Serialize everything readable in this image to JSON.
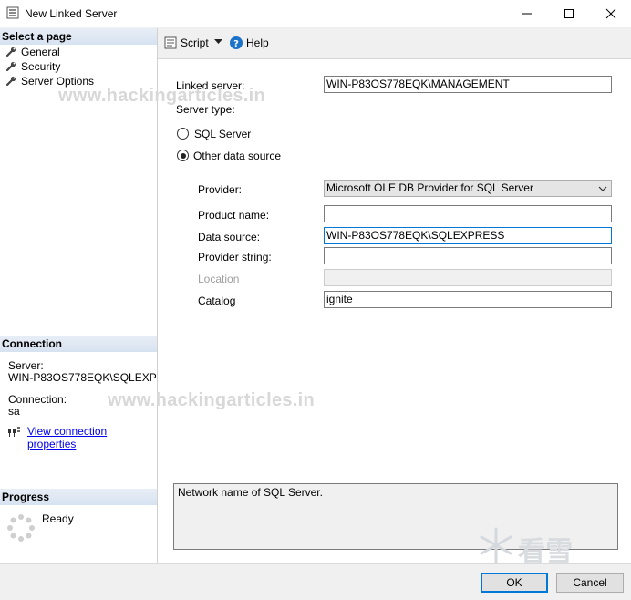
{
  "window": {
    "title": "New Linked Server",
    "minimize_icon": "minimize-icon",
    "maximize_icon": "maximize-icon",
    "close_icon": "close-icon"
  },
  "left": {
    "select_page_header": "Select a page",
    "pages": [
      {
        "label": "General",
        "icon": "wrench-icon"
      },
      {
        "label": "Security",
        "icon": "wrench-icon"
      },
      {
        "label": "Server Options",
        "icon": "wrench-icon"
      }
    ],
    "connection_header": "Connection",
    "server_label": "Server:",
    "server_value": "WIN-P83OS778EQK\\SQLEXPRE",
    "connection_label": "Connection:",
    "connection_value": "sa",
    "view_connection_link": "View connection properties",
    "progress_header": "Progress",
    "progress_status": "Ready"
  },
  "watermark": {
    "text": "www.hackingarticles.in",
    "corner_text": "看雪"
  },
  "toolbar": {
    "script_label": "Script",
    "help_label": "Help"
  },
  "form": {
    "linked_server_label": "Linked server:",
    "linked_server_value": "WIN-P83OS778EQK\\MANAGEMENT",
    "server_type_label": "Server type:",
    "sql_server_option": "SQL Server",
    "other_source_option": "Other data source",
    "selected_server_type": "Other data source",
    "provider_label": "Provider:",
    "provider_value": "Microsoft OLE DB Provider for SQL Server",
    "product_name_label": "Product name:",
    "product_name_value": "",
    "data_source_label": "Data source:",
    "data_source_value": "WIN-P83OS778EQK\\SQLEXPRESS",
    "provider_string_label": "Provider string:",
    "provider_string_value": "",
    "location_label": "Location",
    "location_value": "",
    "catalog_label": "Catalog",
    "catalog_value": "ignite"
  },
  "description": "Network name of SQL Server.",
  "buttons": {
    "ok": "OK",
    "cancel": "Cancel"
  },
  "colors": {
    "section_header": "#d7e2f1",
    "link": "#0000ee",
    "focus_border": "#0078d7",
    "help_icon": "#1a73c8"
  }
}
